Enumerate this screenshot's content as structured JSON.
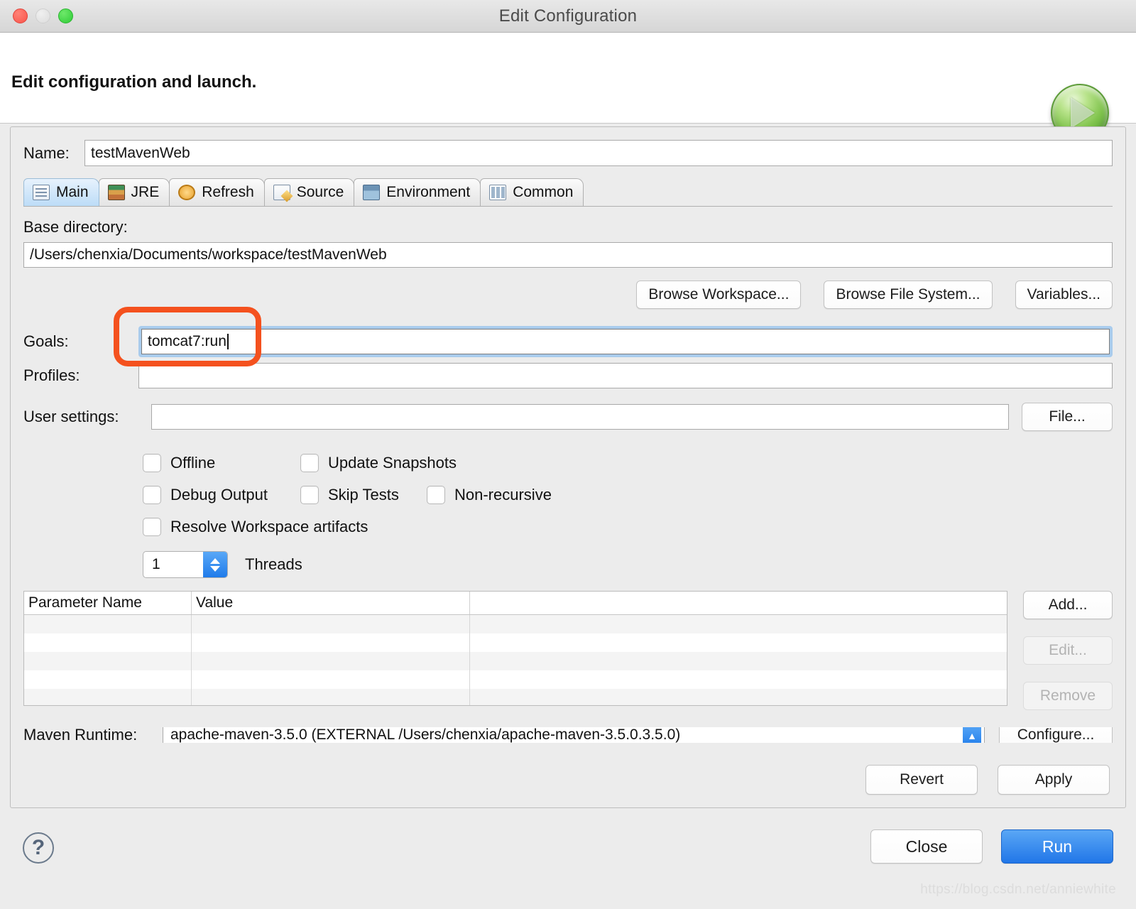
{
  "window": {
    "title": "Edit Configuration",
    "traffic_lights": [
      "close-button",
      "minimize-button",
      "zoom-button"
    ]
  },
  "header": {
    "heading": "Edit configuration and launch.",
    "badge_icon": "run-play-icon"
  },
  "name_row": {
    "label": "Name:",
    "value": "testMavenWeb"
  },
  "tabs": [
    {
      "label": "Main",
      "icon": "main-clipboard-icon",
      "active": true
    },
    {
      "label": "JRE",
      "icon": "jre-books-icon",
      "active": false
    },
    {
      "label": "Refresh",
      "icon": "refresh-arrows-icon",
      "active": false
    },
    {
      "label": "Source",
      "icon": "source-pencil-icon",
      "active": false
    },
    {
      "label": "Environment",
      "icon": "environment-icon",
      "active": false
    },
    {
      "label": "Common",
      "icon": "common-table-icon",
      "active": false
    }
  ],
  "main_tab": {
    "base_directory": {
      "label": "Base directory:",
      "value": "/Users/chenxia/Documents/workspace/testMavenWeb"
    },
    "browse_buttons": [
      {
        "label": "Browse Workspace...",
        "name": "browse-workspace-button"
      },
      {
        "label": "Browse File System...",
        "name": "browse-file-system-button"
      },
      {
        "label": "Variables...",
        "name": "variables-button"
      }
    ],
    "goals": {
      "label": "Goals:",
      "value": "tomcat7:run",
      "focused": true,
      "highlight_color": "#f4511e"
    },
    "profiles": {
      "label": "Profiles:",
      "value": ""
    },
    "user_settings": {
      "label": "User settings:",
      "value": "",
      "file_button": "File..."
    },
    "checkboxes": [
      [
        {
          "label": "Offline",
          "checked": false,
          "name": "offline-checkbox"
        },
        {
          "label": "Update Snapshots",
          "checked": false,
          "name": "update-snapshots-checkbox"
        }
      ],
      [
        {
          "label": "Debug Output",
          "checked": false,
          "name": "debug-output-checkbox"
        },
        {
          "label": "Skip Tests",
          "checked": false,
          "name": "skip-tests-checkbox"
        },
        {
          "label": "Non-recursive",
          "checked": false,
          "name": "non-recursive-checkbox"
        }
      ],
      [
        {
          "label": "Resolve Workspace artifacts",
          "checked": false,
          "name": "resolve-workspace-artifacts-checkbox"
        }
      ]
    ],
    "threads": {
      "value": "1",
      "label": "Threads"
    },
    "parameters_table": {
      "columns": [
        "Parameter Name",
        "Value",
        ""
      ],
      "rows": [],
      "empty_row_count": 5,
      "buttons": [
        {
          "label": "Add...",
          "enabled": true,
          "name": "add-parameter-button"
        },
        {
          "label": "Edit...",
          "enabled": false,
          "name": "edit-parameter-button"
        },
        {
          "label": "Remove",
          "enabled": false,
          "name": "remove-parameter-button"
        }
      ]
    },
    "maven_runtime": {
      "label": "Maven Runtime:",
      "value": "apache-maven-3.5.0 (EXTERNAL  /Users/chenxia/apache-maven-3.5.0.3.5.0)",
      "configure_button": "Configure..."
    }
  },
  "panel_buttons": {
    "revert": "Revert",
    "apply": "Apply"
  },
  "footer": {
    "help_icon": "help-question-icon",
    "close": "Close",
    "run": "Run",
    "watermark": "https://blog.csdn.net/anniewhite"
  }
}
